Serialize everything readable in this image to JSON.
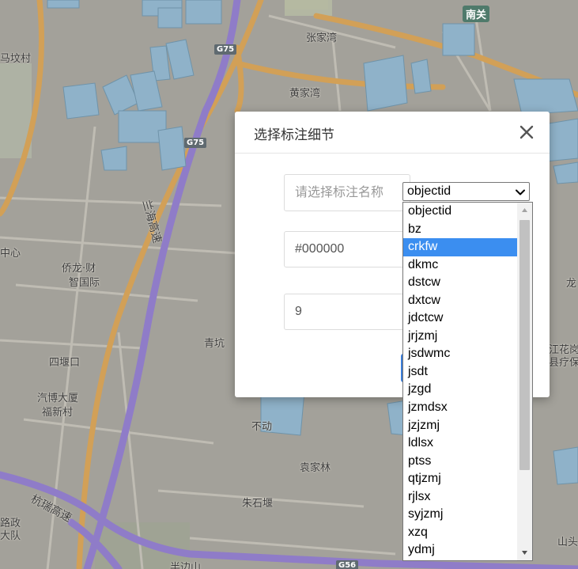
{
  "map": {
    "labels": [
      "马坟村",
      "张家湾",
      "黄家湾",
      "中心",
      "侨龙·财",
      "智国际",
      "四堰口",
      "汽博大厦",
      "福新村",
      "青坑",
      "袁家林",
      "朱石堰",
      "路政",
      "大队",
      "半边山",
      "龙",
      "江花岗",
      "县疗保",
      "山头",
      "不动"
    ],
    "shields": [
      "G75",
      "G75",
      "G56"
    ],
    "station": "南关",
    "roads": [
      "兰海高速",
      "杭瑞高速"
    ]
  },
  "modal": {
    "title": "选择标注细节",
    "close_icon": "close-icon",
    "name_placeholder": "请选择标注名称",
    "color_value": "#000000",
    "size_value": "9"
  },
  "select": {
    "selected": "objectid",
    "highlighted": "crkfw",
    "options": [
      "objectid",
      "bz",
      "crkfw",
      "dkmc",
      "dstcw",
      "dxtcw",
      "jdctcw",
      "jrjzmj",
      "jsdwmc",
      "jsdt",
      "jzgd",
      "jzmdsx",
      "jzjzmj",
      "ldlsx",
      "ptss",
      "qtjzmj",
      "rjlsx",
      "syjzmj",
      "xzq",
      "ydmj"
    ]
  },
  "colors": {
    "accent": "#3a7dd9",
    "highlight": "#3b8ef0",
    "highway": "#8f7cc8",
    "main_road": "#d6a45a"
  }
}
